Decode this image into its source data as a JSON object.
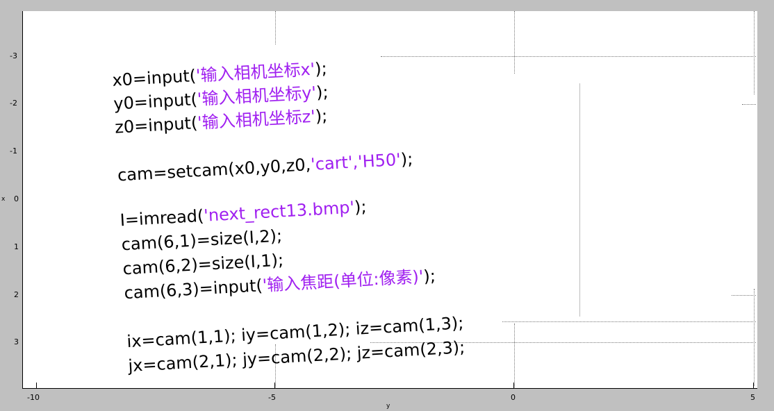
{
  "axes": {
    "xlabel": "y",
    "ylabel": "x",
    "x_ticks": [
      "-10",
      "-5",
      "0",
      "5"
    ],
    "y_ticks": [
      "-3",
      "-2",
      "-1",
      "0",
      "1",
      "2",
      "3"
    ]
  },
  "code_lines": [
    {
      "black": "x0=input(",
      "purple": "'输入相机坐标x'",
      "tail": ");"
    },
    {
      "black": "y0=input(",
      "purple": "'输入相机坐标y'",
      "tail": ");"
    },
    {
      "black": "z0=input(",
      "purple": "'输入相机坐标z'",
      "tail": ");"
    },
    {
      "black": "cam=setcam(x0,y0,z0,",
      "purple": "'cart','H50'",
      "tail": ");"
    },
    {
      "black": "I=imread(",
      "purple": "'next_rect13.bmp'",
      "tail": ");"
    },
    {
      "black": "cam(6,1)=size(I,2);",
      "purple": "",
      "tail": ""
    },
    {
      "black": "cam(6,2)=size(I,1);",
      "purple": "",
      "tail": ""
    },
    {
      "black": "cam(6,3)=input(",
      "purple": "'输入焦距(单位:像素)'",
      "tail": ");"
    },
    {
      "black": "ix=cam(1,1); iy=cam(1,2); iz=cam(1,3);",
      "purple": "",
      "tail": ""
    },
    {
      "black": "jx=cam(2,1); jy=cam(2,2); jz=cam(2,3);",
      "purple": "",
      "tail": ""
    }
  ],
  "colors": {
    "code_black": "#000000",
    "code_purple": "#a020f0",
    "figure_bg": "#c0c0c0",
    "axes_bg": "#ffffff"
  }
}
